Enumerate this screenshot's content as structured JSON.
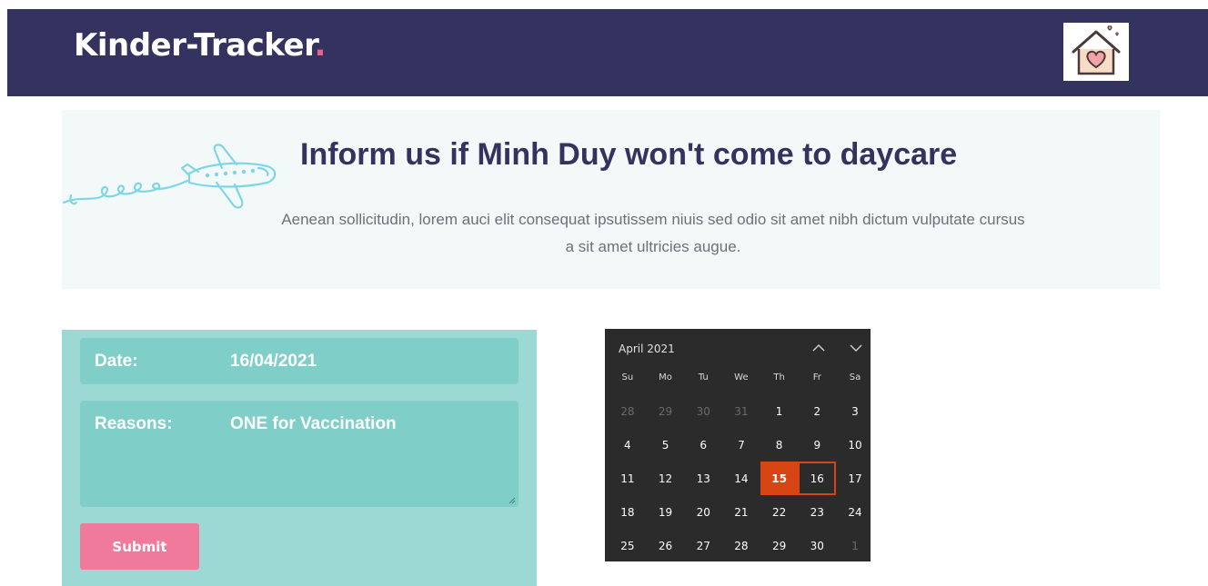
{
  "header": {
    "brand": "Kinder-Tracker",
    "brand_dot": ".",
    "logo_icon": "house-heart-icon"
  },
  "hero": {
    "title": "Inform us if Minh Duy won't come to daycare",
    "text": "Aenean sollicitudin, lorem auci elit consequat ipsutissem niuis sed odio sit amet nibh dictum vulputate cursus a sit amet ultricies augue.",
    "illustration": "airplane-icon"
  },
  "form": {
    "date_label": "Date:",
    "date_value": "16/04/2021",
    "reason_label": "Reasons:",
    "reason_value": "ONE for Vaccination",
    "submit_label": "Submit"
  },
  "calendar": {
    "month_label": "April 2021",
    "weekdays": [
      "Su",
      "Mo",
      "Tu",
      "We",
      "Th",
      "Fr",
      "Sa"
    ],
    "today": 15,
    "selected": 16,
    "today_color": "#d84515",
    "days": [
      {
        "d": "28",
        "other": true
      },
      {
        "d": "29",
        "other": true
      },
      {
        "d": "30",
        "other": true
      },
      {
        "d": "31",
        "other": true
      },
      {
        "d": "1"
      },
      {
        "d": "2"
      },
      {
        "d": "3"
      },
      {
        "d": "4"
      },
      {
        "d": "5"
      },
      {
        "d": "6"
      },
      {
        "d": "7"
      },
      {
        "d": "8"
      },
      {
        "d": "9"
      },
      {
        "d": "10"
      },
      {
        "d": "11"
      },
      {
        "d": "12"
      },
      {
        "d": "13"
      },
      {
        "d": "14"
      },
      {
        "d": "15"
      },
      {
        "d": "16"
      },
      {
        "d": "17"
      },
      {
        "d": "18"
      },
      {
        "d": "19"
      },
      {
        "d": "20"
      },
      {
        "d": "21"
      },
      {
        "d": "22"
      },
      {
        "d": "23"
      },
      {
        "d": "24"
      },
      {
        "d": "25"
      },
      {
        "d": "26"
      },
      {
        "d": "27"
      },
      {
        "d": "28"
      },
      {
        "d": "29"
      },
      {
        "d": "30"
      },
      {
        "d": "1",
        "other": true
      }
    ]
  },
  "colors": {
    "header_bg": "#34335f",
    "accent_pink": "#ef5f8b",
    "form_bg": "#9dd9d4",
    "field_bg": "#7fcfc8",
    "submit_bg": "#f07a9c",
    "calendar_bg": "#2b2b2b"
  }
}
